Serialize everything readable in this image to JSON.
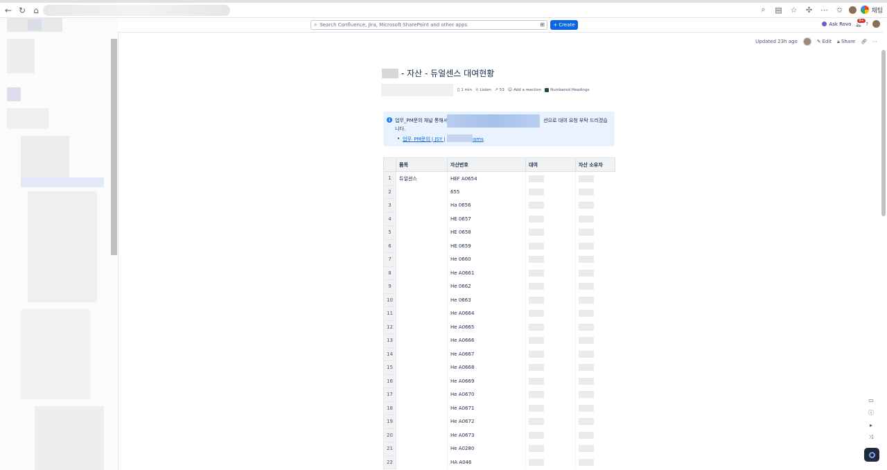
{
  "browser": {
    "profile_name": "채팅"
  },
  "topbar": {
    "search_placeholder": "Search Confluence, Jira, Microsoft SharePoint and other apps",
    "create_label": "Create",
    "ask_rovo_label": "Ask Rovo",
    "notification_badge": "9+"
  },
  "page_actions": {
    "updated": "Updated 23h ago",
    "edit": "Edit",
    "share": "Share"
  },
  "page": {
    "title": "- 자산 - 듀얼센스 대여현황",
    "meta": {
      "read_time": "1 min",
      "listen": "Listen",
      "views": "53",
      "reaction": "Add a reaction",
      "numbered_headings": "Numbered Headings"
    },
    "info": {
      "text_before": "업무_PM문의 채널 통해서",
      "text_after": "션으로 대여 요청 부탁 드리겠습니다.",
      "link_prefix": "업무_PM문의 | JSY |",
      "link_suffix": "eams"
    }
  },
  "table": {
    "headers": [
      "",
      "품목",
      "자산번호",
      "대여",
      "자산 소유자"
    ],
    "rows": [
      {
        "n": "1",
        "item": "듀얼센스",
        "asset": "HEF      A0654"
      },
      {
        "n": "2",
        "item": "",
        "asset": "      655"
      },
      {
        "n": "3",
        "item": "",
        "asset": "Ha       0656"
      },
      {
        "n": "4",
        "item": "",
        "asset": "HE       0657"
      },
      {
        "n": "5",
        "item": "",
        "asset": "HE       0658"
      },
      {
        "n": "6",
        "item": "",
        "asset": "HE       0659"
      },
      {
        "n": "7",
        "item": "",
        "asset": "He       0660"
      },
      {
        "n": "8",
        "item": "",
        "asset": "He      A0661"
      },
      {
        "n": "9",
        "item": "",
        "asset": "He       0662"
      },
      {
        "n": "10",
        "item": "",
        "asset": "He       0663"
      },
      {
        "n": "11",
        "item": "",
        "asset": "He      A0664"
      },
      {
        "n": "12",
        "item": "",
        "asset": "He      A0665"
      },
      {
        "n": "13",
        "item": "",
        "asset": "He      A0666"
      },
      {
        "n": "14",
        "item": "",
        "asset": "He      A0667"
      },
      {
        "n": "15",
        "item": "",
        "asset": "He      A0668"
      },
      {
        "n": "16",
        "item": "",
        "asset": "He      A0669"
      },
      {
        "n": "17",
        "item": "",
        "asset": "He      A0670"
      },
      {
        "n": "18",
        "item": "",
        "asset": "He      A0671"
      },
      {
        "n": "19",
        "item": "",
        "asset": "He      A0672"
      },
      {
        "n": "20",
        "item": "",
        "asset": "He      A0673"
      },
      {
        "n": "21",
        "item": "",
        "asset": "He      A0280"
      },
      {
        "n": "22",
        "item": "",
        "asset": "HA      A046"
      }
    ]
  }
}
